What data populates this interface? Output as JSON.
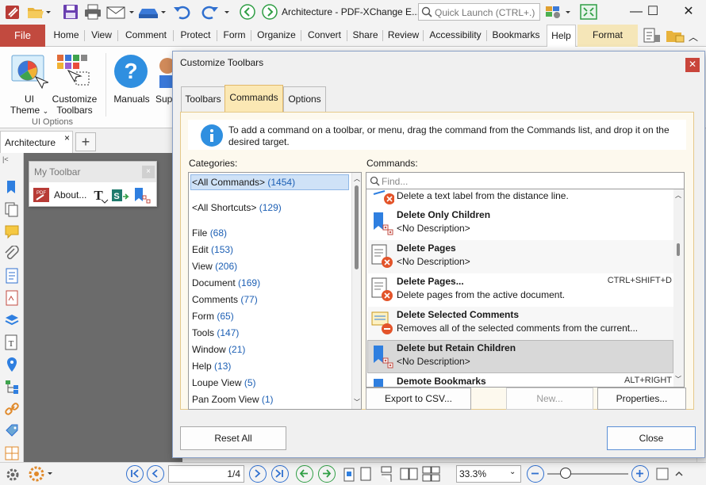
{
  "window": {
    "title": "Architecture - PDF-XChange E...",
    "quick_launch_placeholder": "Quick Launch (CTRL+.)"
  },
  "ribbon_tabs": [
    "File",
    "Home",
    "View",
    "Comment",
    "Protect",
    "Form",
    "Organize",
    "Convert",
    "Share",
    "Review",
    "Accessibility",
    "Bookmarks",
    "Help",
    "Format"
  ],
  "ribbon": {
    "ui_theme": [
      "UI",
      "Theme"
    ],
    "customize_toolbars": [
      "Customize",
      "Toolbars"
    ],
    "manuals": "Manuals",
    "support_partial": "Sup",
    "group_label": "UI Options"
  },
  "document": {
    "tab_title": "Architecture"
  },
  "my_toolbar": {
    "title": "My Toolbar",
    "about_label": "About..."
  },
  "dialog": {
    "title": "Customize Toolbars",
    "tabs": [
      "Toolbars",
      "Commands",
      "Options"
    ],
    "info": "To add a command on a toolbar, or menu, drag the command from the Commands list, and drop it on the desired target.",
    "categories_label": "Categories:",
    "commands_label": "Commands:",
    "find_placeholder": "Find...",
    "categories": [
      {
        "name": "<All Commands>",
        "count": "(1454)"
      },
      {
        "name": "<All Shortcuts>",
        "count": "(129)"
      },
      {
        "name": "File",
        "count": "(68)"
      },
      {
        "name": "Edit",
        "count": "(153)"
      },
      {
        "name": "View",
        "count": "(206)"
      },
      {
        "name": "Document",
        "count": "(169)"
      },
      {
        "name": "Comments",
        "count": "(77)"
      },
      {
        "name": "Form",
        "count": "(65)"
      },
      {
        "name": "Tools",
        "count": "(147)"
      },
      {
        "name": "Window",
        "count": "(21)"
      },
      {
        "name": "Help",
        "count": "(13)"
      },
      {
        "name": "Loupe View",
        "count": "(5)"
      },
      {
        "name": "Pan Zoom View",
        "count": "(1)"
      }
    ],
    "partial_top_desc": "Delete a text label from the distance line.",
    "commands": [
      {
        "name": "Delete Only Children",
        "desc": "<No Description>",
        "shortcut": ""
      },
      {
        "name": "Delete Pages",
        "desc": "<No Description>",
        "shortcut": ""
      },
      {
        "name": "Delete Pages...",
        "desc": "Delete pages from the active document.",
        "shortcut": "CTRL+SHIFT+D"
      },
      {
        "name": "Delete Selected Comments",
        "desc": "Removes all of the selected comments from the current...",
        "shortcut": ""
      },
      {
        "name": "Delete but Retain Children",
        "desc": "<No Description>",
        "shortcut": ""
      },
      {
        "name": "Demote Bookmarks",
        "desc": "",
        "shortcut": "ALT+RIGHT"
      }
    ],
    "buttons": {
      "export": "Export to CSV...",
      "new": "New...",
      "properties": "Properties...",
      "reset_all": "Reset All",
      "close": "Close"
    }
  },
  "statusbar": {
    "page_display": "1/4",
    "zoom": "33.3%"
  },
  "colors": {
    "file_tab": "#c24a3f",
    "format_tab": "#f5e6b8",
    "dialog_panel": "#fdf9ee",
    "selection": "#cfe2f7",
    "accent_blue": "#2f6fcf"
  }
}
